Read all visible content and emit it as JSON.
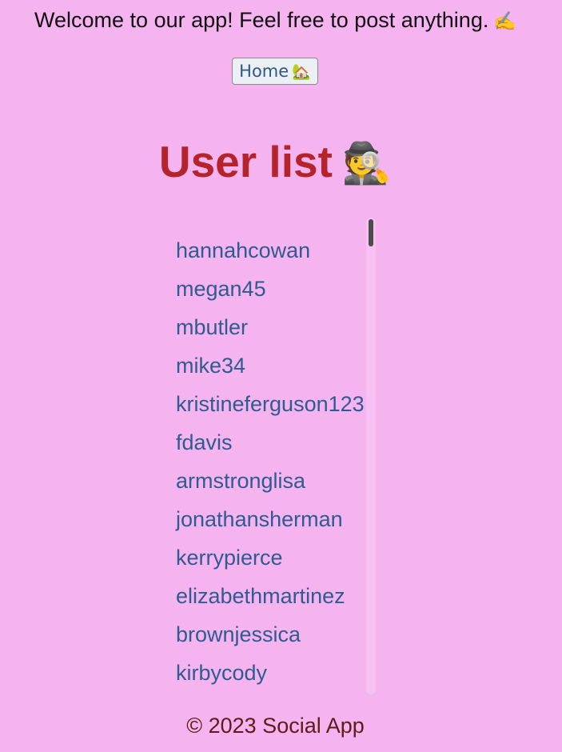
{
  "header": {
    "welcome_text": "Welcome to our app! Feel free to post anything.",
    "welcome_icon": "✍️",
    "welcome_icon_name": "memo-icon"
  },
  "nav": {
    "home_label": "Home",
    "home_icon": "🏡",
    "home_icon_name": "house-icon"
  },
  "main": {
    "title": "User list",
    "title_icon": "🕵️",
    "title_icon_name": "detective-icon",
    "users": [
      "hannahcowan",
      "megan45",
      "mbutler",
      "mike34",
      "kristineferguson123",
      "fdavis",
      "armstronglisa",
      "jonathansherman",
      "kerrypierce",
      "elizabethmartinez",
      "brownjessica",
      "kirbycody"
    ]
  },
  "footer": {
    "text": "© 2023 Social App"
  },
  "colors": {
    "background": "#f5b3f0",
    "title": "#b5242b",
    "user_link": "#2f5c8f",
    "footer_text": "#5a1d18"
  }
}
